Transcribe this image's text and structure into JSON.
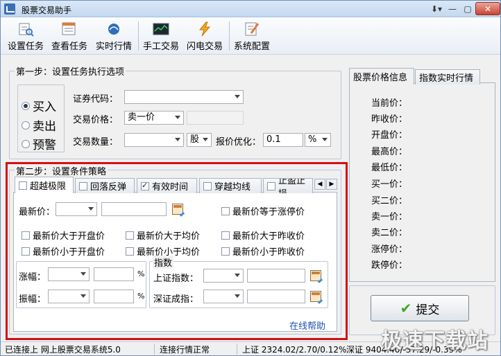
{
  "window": {
    "title": "股票交易助手"
  },
  "toolbar": {
    "items": [
      {
        "label": "设置任务",
        "icon": "settings-task-icon"
      },
      {
        "label": "查看任务",
        "icon": "view-task-icon"
      },
      {
        "label": "实时行情",
        "icon": "realtime-quote-icon"
      },
      {
        "label": "手工交易",
        "icon": "manual-trade-icon"
      },
      {
        "label": "闪电交易",
        "icon": "lightning-trade-icon"
      },
      {
        "label": "系统配置",
        "icon": "system-config-icon"
      }
    ]
  },
  "step1": {
    "title": "第一步：设置任务执行选项",
    "order_types": [
      {
        "label": "买入",
        "selected": true
      },
      {
        "label": "卖出",
        "selected": false
      },
      {
        "label": "预警",
        "selected": false
      }
    ],
    "code_label": "证券代码：",
    "code_value": "",
    "price_label": "交易价格：",
    "price_value": "卖一价",
    "qty_label": "交易数量：",
    "qty_value": "",
    "unit_value": "股",
    "opt_label": "报价优化：",
    "opt_value": "0.1",
    "opt_unit": "%"
  },
  "step2": {
    "title": "第二步：设置条件策略",
    "tabs": [
      {
        "label": "超越极限",
        "checked": false
      },
      {
        "label": "回落反弹",
        "checked": false
      },
      {
        "label": "有效时间",
        "checked": true
      },
      {
        "label": "穿越均线",
        "checked": false
      },
      {
        "label": "止盈止损",
        "checked": false
      }
    ],
    "latest_label": "最新价：",
    "latest_eq_limit": "最新价等于涨停价",
    "conditions": [
      "最新价大于开盘价",
      "最新价大于均价",
      "最新价大于昨收价",
      "最新价小于开盘价",
      "最新价小于均价",
      "最新价小于昨收价"
    ],
    "rise_label": "涨幅：",
    "amp_label": "振幅：",
    "percent": "%",
    "index_title": "指数",
    "sh_index_label": "上证指数：",
    "sz_index_label": "深证成指：",
    "help_link": "在线帮助"
  },
  "right_panel": {
    "tabs": [
      "股票价格信息",
      "指数实时行情"
    ],
    "fields": [
      "当前价：",
      "昨收价：",
      "开盘价：",
      "最高价：",
      "最低价：",
      "买一价：",
      "买二价：",
      "卖一价：",
      "卖二价：",
      "涨停价：",
      "跌停价："
    ],
    "submit_label": "提交"
  },
  "status": {
    "connection": "已连接上 网上股票交易系统5.0",
    "quote": "连接行情正常",
    "sh": "上证 2324.02/2.70/0.12%",
    "sz": "深证 9404.40/-37.29/-0.39%"
  },
  "watermark": "极速下载站",
  "colors": {
    "highlight_frame": "#d40f14",
    "link": "#1f4fb8"
  }
}
